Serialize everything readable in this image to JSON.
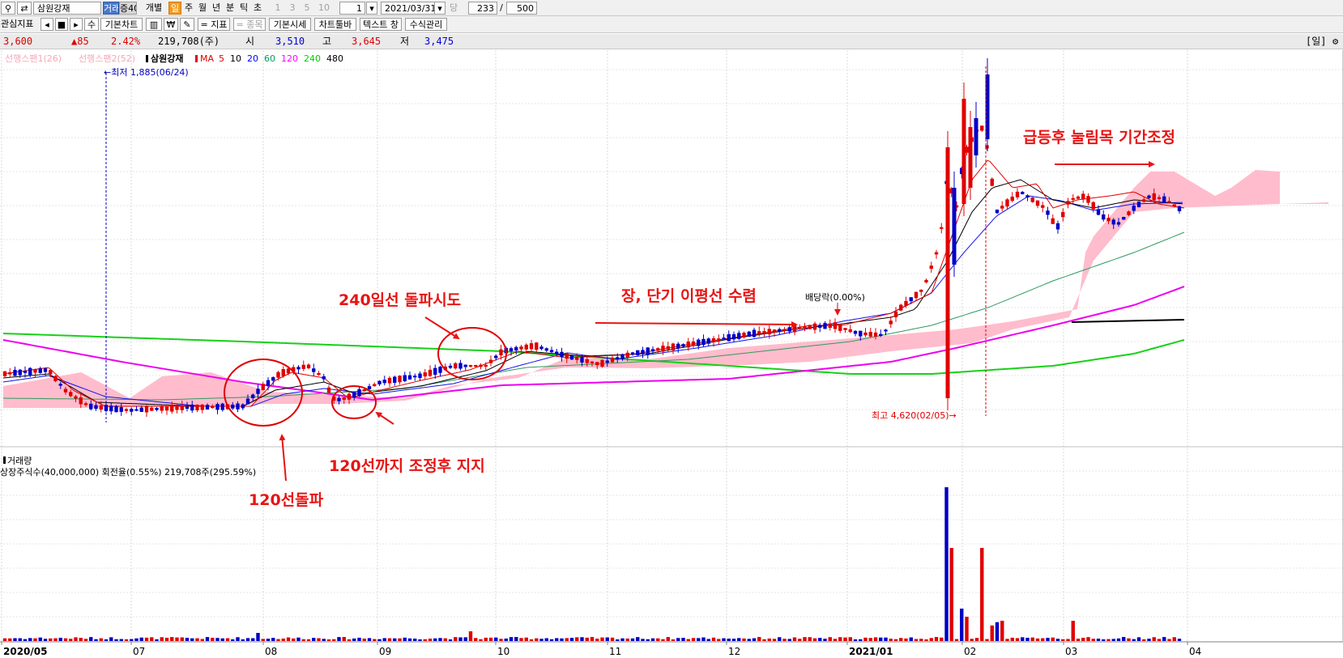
{
  "toolbar1": {
    "stock_name": "삼원강재",
    "btn_exchange": "거래",
    "btn_margin": "증40",
    "btn_individual": "개별",
    "periods": [
      "일",
      "주",
      "월",
      "년",
      "분",
      "틱",
      "초"
    ],
    "active_period": "일",
    "intervals": [
      "1",
      "3",
      "5",
      "10"
    ],
    "interval_value": "1",
    "date_value": "2021/03/31",
    "date_label": "당",
    "count_value": "233",
    "slash": "/",
    "count_total": "500"
  },
  "toolbar2": {
    "watchlist_label": "관심지표",
    "prev_symbol": "◂",
    "stop_symbol": "■",
    "next_symbol": "▸",
    "receive_label": "수",
    "basic_chart_label": "기본차트",
    "indicator_label": "= 지표",
    "stock_label": "= 종목",
    "basic_price_label": "기본시세",
    "chart_toolbar_label": "차트툴바",
    "text_label": "텍스트 창",
    "formula_label": "수식관리"
  },
  "quote": {
    "price": "3,600",
    "change": "▲85",
    "change_pct": "2.42%",
    "volume": "219,708(주)",
    "open_label": "시",
    "open": "3,510",
    "high_label": "고",
    "high": "3,645",
    "low_label": "저",
    "low": "3,475",
    "period_badge": "[일]"
  },
  "legend": {
    "span1": "선행스팬1(26)",
    "span2": "선행스팬2(52)",
    "stock": "삼원강재",
    "ma_label": "MA",
    "ma": [
      {
        "period": "5",
        "color": "#e00000"
      },
      {
        "period": "10",
        "color": "#000000"
      },
      {
        "period": "20",
        "color": "#0000ff"
      },
      {
        "period": "60",
        "color": "#00a060"
      },
      {
        "period": "120",
        "color": "#ff00ff"
      },
      {
        "period": "240",
        "color": "#00cc00"
      },
      {
        "period": "480",
        "color": "#000000"
      }
    ]
  },
  "labels": {
    "low_marker": "←최저 1,885(06/24)",
    "high_marker": "최고 4,620(02/05)→",
    "dividend": "배당락(0.00%)",
    "volume_title": "거래량",
    "volume_info": "상장주식수(40,000,000) 회전율(0.55%) 219,708주(295.59%)"
  },
  "annotations": {
    "a1": "급등후 눌림목 기간조정",
    "a2": "장, 단기 이평선 수렴",
    "a3": "240일선 돌파시도",
    "a4": "120선까지 조정후 지지",
    "a5": "120선돌파"
  },
  "x_axis": [
    "2020/05",
    "07",
    "08",
    "09",
    "10",
    "11",
    "12",
    "2021/01",
    "02",
    "03",
    "04"
  ],
  "colors": {
    "up": "#e00000",
    "down": "#0000c8",
    "ichimoku_cloud": "#ffb8c8",
    "annotation": "#e81414"
  }
}
